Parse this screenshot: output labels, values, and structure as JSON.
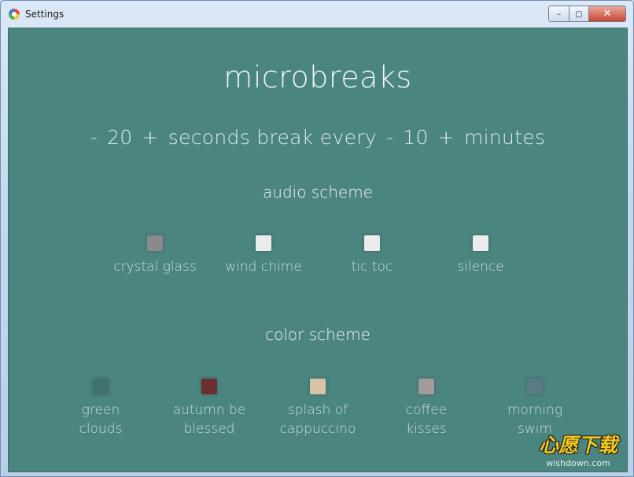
{
  "window": {
    "title": "Settings",
    "icon": "app-icon"
  },
  "controls": {
    "minimize": "–",
    "maximize": "◻",
    "close": "✕"
  },
  "header": {
    "title": "microbreaks"
  },
  "break": {
    "seconds_minus": "-",
    "seconds": "20",
    "seconds_plus": "+",
    "middle": "seconds break every",
    "minutes_minus": "-",
    "minutes": "10",
    "minutes_plus": "+",
    "unit": "minutes"
  },
  "audio": {
    "title": "audio scheme",
    "options": [
      {
        "label": "crystal glass",
        "color": "#8a8a8a"
      },
      {
        "label": "wind chime",
        "color": "#ececec"
      },
      {
        "label": "tic toc",
        "color": "#ececec"
      },
      {
        "label": "silence",
        "color": "#ececec"
      }
    ]
  },
  "colors": {
    "title": "color scheme",
    "options": [
      {
        "line1": "green",
        "line2": "clouds",
        "color": "#41716d"
      },
      {
        "line1": "autumn be",
        "line2": "blessed",
        "color": "#6b2f31"
      },
      {
        "line1": "splash of",
        "line2": "cappuccino",
        "color": "#d7c4a6"
      },
      {
        "line1": "coffee",
        "line2": "kisses",
        "color": "#a49b9b"
      },
      {
        "line1": "morning",
        "line2": "swim",
        "color": "#5c7a85"
      }
    ]
  },
  "watermark": {
    "main": "心愿下载",
    "sub": "wishdown.com"
  }
}
